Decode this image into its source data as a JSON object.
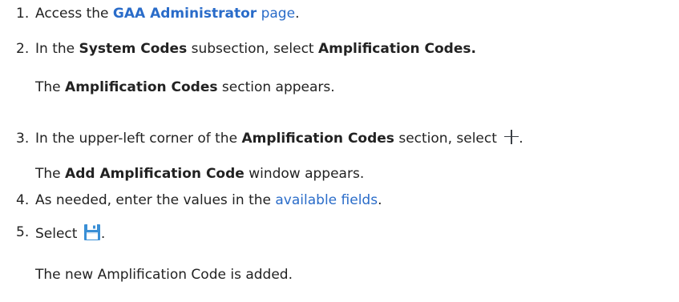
{
  "steps": [
    {
      "number": "1.",
      "prefix": "Access the ",
      "link_bold": "GAA Administrator",
      "link_suffix": " page",
      "end": "."
    },
    {
      "number": "2.",
      "prefix": "In the ",
      "bold1": "System Codes",
      "middle": " subsection, select ",
      "bold2": "Amplification Codes.",
      "result_prefix": "The ",
      "result_bold": "Amplification Codes",
      "result_suffix": " section appears."
    },
    {
      "number": "3.",
      "prefix": "In the upper-left corner of the ",
      "bold1": "Amplification Codes",
      "middle": " section, select ",
      "icon": "plus-icon",
      "end": ".",
      "result_prefix": "The ",
      "result_bold": "Add Amplification Code",
      "result_suffix": " window appears."
    },
    {
      "number": "4.",
      "prefix": "As needed, enter the values in the ",
      "link": "available fields",
      "end": "."
    },
    {
      "number": "5.",
      "prefix": "Select ",
      "icon": "save-icon",
      "end": ".",
      "result": "The new Amplification Code is added."
    }
  ],
  "colors": {
    "text": "#222222",
    "link": "#2a6cc9",
    "save_icon": "#3a8fd6"
  }
}
